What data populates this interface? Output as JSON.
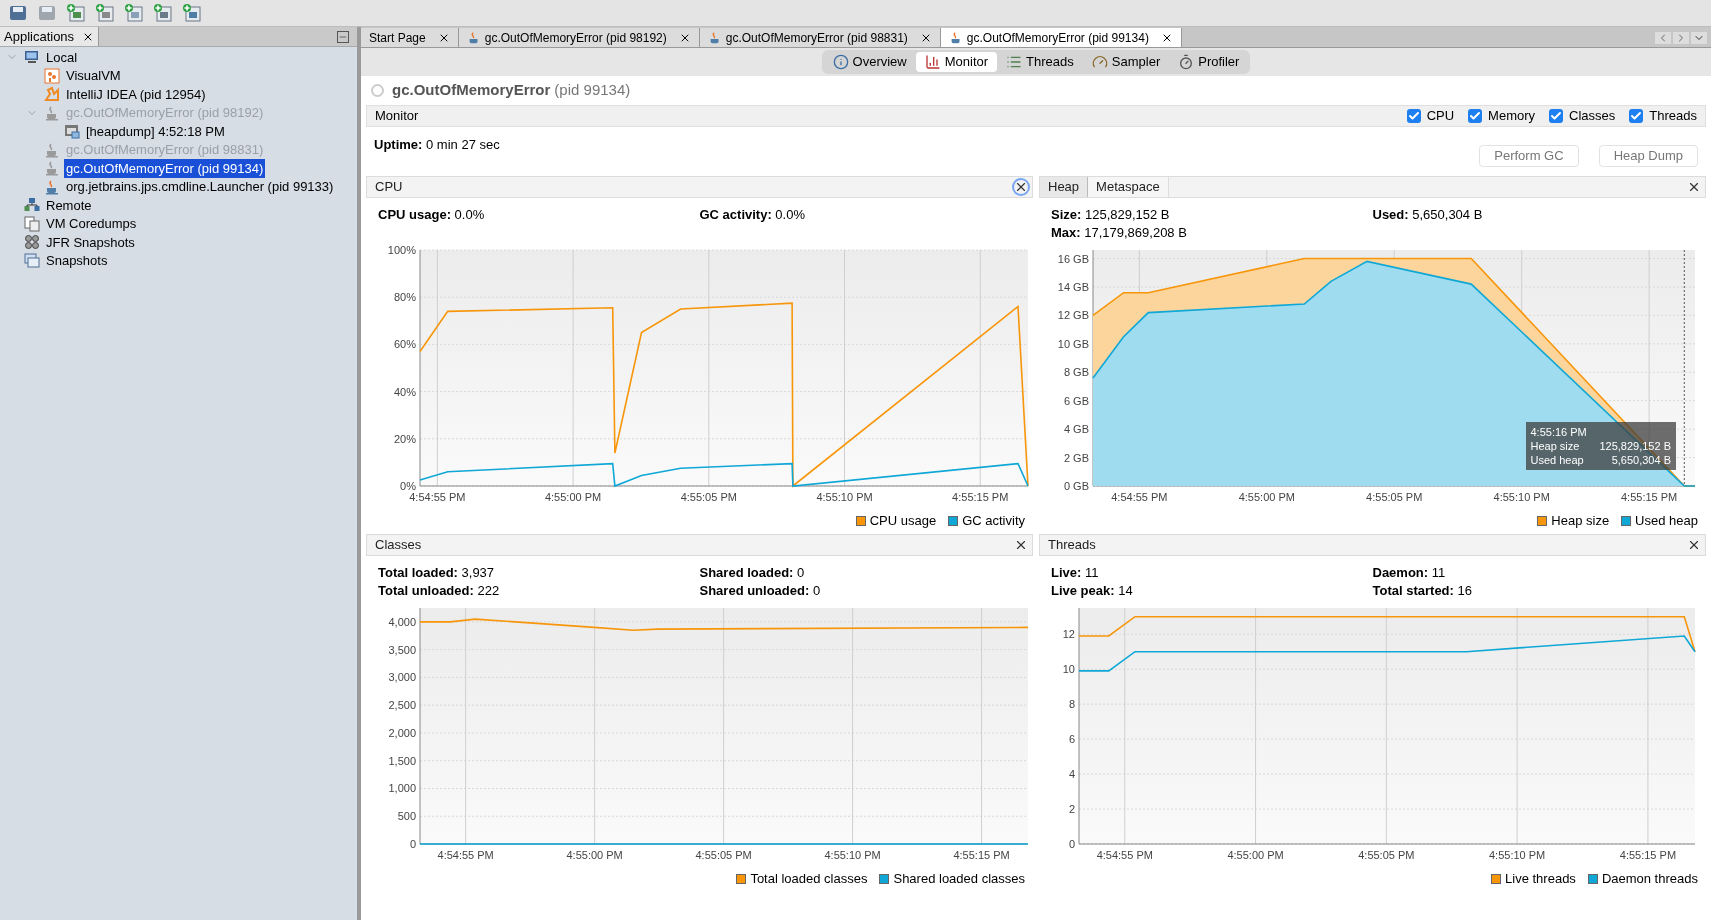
{
  "sidebar": {
    "tab": {
      "label": "Applications"
    },
    "tree": [
      {
        "label": "Local",
        "kind": "host",
        "selected": false,
        "disabled": false,
        "expanded": true,
        "children": [
          {
            "label": "VisualVM",
            "kind": "visualvm",
            "selected": false,
            "disabled": false
          },
          {
            "label": "IntelliJ IDEA (pid 12954)",
            "kind": "idea",
            "selected": false,
            "disabled": false
          },
          {
            "label": "gc.OutOfMemoryError (pid 98192)",
            "kind": "java",
            "selected": false,
            "disabled": true,
            "expanded": true,
            "children": [
              {
                "label": "[heapdump] 4:52:18 PM",
                "kind": "heapdump",
                "selected": false,
                "disabled": false
              }
            ]
          },
          {
            "label": "gc.OutOfMemoryError (pid 98831)",
            "kind": "java",
            "selected": false,
            "disabled": true
          },
          {
            "label": "gc.OutOfMemoryError (pid 99134)",
            "kind": "java",
            "selected": true,
            "disabled": false
          },
          {
            "label": "org.jetbrains.jps.cmdline.Launcher (pid 99133)",
            "kind": "launcher",
            "selected": false,
            "disabled": false
          }
        ]
      },
      {
        "label": "Remote",
        "kind": "remote",
        "selected": false,
        "disabled": false
      },
      {
        "label": "VM Coredumps",
        "kind": "coredumps",
        "selected": false,
        "disabled": false
      },
      {
        "label": "JFR Snapshots",
        "kind": "jfr",
        "selected": false,
        "disabled": false
      },
      {
        "label": "Snapshots",
        "kind": "snapshots",
        "selected": false,
        "disabled": false
      }
    ]
  },
  "tabs": [
    {
      "label": "Start Page",
      "kind": "page",
      "selected": false
    },
    {
      "label": "gc.OutOfMemoryError (pid 98192)",
      "kind": "java",
      "selected": false
    },
    {
      "label": "gc.OutOfMemoryError (pid 98831)",
      "kind": "java",
      "selected": false
    },
    {
      "label": "gc.OutOfMemoryError (pid 99134)",
      "kind": "java",
      "selected": true
    }
  ],
  "views": [
    {
      "label": "Overview",
      "kind": "overview",
      "selected": false
    },
    {
      "label": "Monitor",
      "kind": "monitor",
      "selected": true
    },
    {
      "label": "Threads",
      "kind": "threads",
      "selected": false
    },
    {
      "label": "Sampler",
      "kind": "sampler",
      "selected": false
    },
    {
      "label": "Profiler",
      "kind": "profiler",
      "selected": false
    }
  ],
  "title": {
    "name": "gc.OutOfMemoryError",
    "pid": "(pid 99134)"
  },
  "monitor": {
    "label": "Monitor",
    "checkboxes": [
      {
        "label": "CPU",
        "checked": true
      },
      {
        "label": "Memory",
        "checked": true
      },
      {
        "label": "Classes",
        "checked": true
      },
      {
        "label": "Threads",
        "checked": true
      }
    ],
    "uptime": "**Uptime:** 0 min 27 sec",
    "buttons": [
      "Perform GC",
      "Heap Dump"
    ]
  },
  "cpu": {
    "tabs": [
      {
        "label": "CPU",
        "selected": true
      }
    ],
    "stats": [
      "**CPU usage:** 0.0%",
      "**GC activity:** 0.0%"
    ],
    "chart_data": {
      "type": "line",
      "grid": true,
      "x": [
        60894.36,
        60895.38,
        60901.46,
        60901.54,
        60902.52,
        60903.96,
        60908.07,
        60908.1,
        60916.39,
        60916.76
      ],
      "xlim": [
        60894.36,
        60916.76
      ],
      "ylim": [
        0,
        100
      ],
      "xticks": [
        {
          "value": 60895,
          "label": "4:54:55 PM"
        },
        {
          "value": 60900,
          "label": "4:55:00 PM"
        },
        {
          "value": 60905,
          "label": "4:55:05 PM"
        },
        {
          "value": 60910,
          "label": "4:55:10 PM"
        },
        {
          "value": 60915,
          "label": "4:55:15 PM"
        }
      ],
      "yticks": [
        {
          "value": 0,
          "label": "0%"
        },
        {
          "value": 20,
          "label": "20%"
        },
        {
          "value": 40,
          "label": "40%"
        },
        {
          "value": 60,
          "label": "60%"
        },
        {
          "value": 80,
          "label": "80%"
        },
        {
          "value": 100,
          "label": "100%"
        }
      ],
      "series": [
        {
          "name": "CPU usage",
          "color": "#f7960a",
          "values": [
            57,
            74,
            75.5,
            14,
            65,
            75,
            77.5,
            0,
            76,
            0
          ]
        },
        {
          "name": "GC activity",
          "color": "#0ea7d6",
          "values": [
            2.5,
            6,
            9.5,
            0,
            4.5,
            7.5,
            9.5,
            0,
            9.5,
            0
          ]
        }
      ]
    }
  },
  "memory": {
    "tabs": [
      {
        "label": "Heap",
        "selected": true
      },
      {
        "label": "Metaspace",
        "selected": false
      }
    ],
    "stats": [
      "**Size:** 125,829,152 B",
      "**Used:** 5,650,304 B",
      "**Max:** 17,179,869,208 B"
    ],
    "chart_data": {
      "type": "area",
      "grid": true,
      "x": [
        60893.18,
        60894.38,
        60895.35,
        60901.47,
        60902.52,
        60903.93,
        60908.02,
        60916.38,
        60916.8
      ],
      "xlim": [
        60893.18,
        60916.8
      ],
      "ylim": [
        0,
        16.6
      ],
      "xticks": [
        {
          "value": 60895,
          "label": "4:54:55 PM"
        },
        {
          "value": 60900,
          "label": "4:55:00 PM"
        },
        {
          "value": 60905,
          "label": "4:55:05 PM"
        },
        {
          "value": 60910,
          "label": "4:55:10 PM"
        },
        {
          "value": 60915,
          "label": "4:55:15 PM"
        }
      ],
      "yticks": [
        {
          "value": 0,
          "label": "0 GB"
        },
        {
          "value": 2,
          "label": "2 GB"
        },
        {
          "value": 4,
          "label": "4 GB"
        },
        {
          "value": 6,
          "label": "6 GB"
        },
        {
          "value": 8,
          "label": "8 GB"
        },
        {
          "value": 10,
          "label": "10 GB"
        },
        {
          "value": 12,
          "label": "12 GB"
        },
        {
          "value": 14,
          "label": "14 GB"
        },
        {
          "value": 16,
          "label": "16 GB"
        }
      ],
      "series": [
        {
          "name": "Heap size",
          "color": "#f7960a",
          "values": [
            12,
            13.6,
            13.6,
            16,
            16,
            16,
            16,
            0,
            0
          ]
        },
        {
          "name": "Used heap",
          "color": "#0ea7d6",
          "values": [
            7.6,
            10.5,
            12.2,
            12.8,
            14.4,
            15.8,
            14.2,
            0,
            0
          ]
        }
      ],
      "ref_lines": [
        {
          "axis": "x",
          "value": 60916.38
        }
      ]
    },
    "tooltip": {
      "time": "4:55:16 PM",
      "rows": [
        {
          "label": "Heap size",
          "value": "125,829,152 B"
        },
        {
          "label": "Used heap",
          "value": "5,650,304 B"
        }
      ]
    }
  },
  "classes": {
    "tabs": [
      {
        "label": "Classes",
        "selected": true
      }
    ],
    "stats": [
      "**Total loaded:** 3,937",
      "**Shared loaded:** 0",
      "**Total unloaded:** 222",
      "**Shared unloaded:** 0"
    ],
    "chart_data": {
      "type": "line",
      "grid": true,
      "x": [
        60893.23,
        60894.41,
        60895.37,
        60899.98,
        60901.5,
        60902.43,
        60916.8
      ],
      "xlim": [
        60893.23,
        60916.8
      ],
      "ylim": [
        0,
        4250
      ],
      "xticks": [
        {
          "value": 60895,
          "label": "4:54:55 PM"
        },
        {
          "value": 60900,
          "label": "4:55:00 PM"
        },
        {
          "value": 60905,
          "label": "4:55:05 PM"
        },
        {
          "value": 60910,
          "label": "4:55:10 PM"
        },
        {
          "value": 60915,
          "label": "4:55:15 PM"
        }
      ],
      "yticks": [
        {
          "value": 0,
          "label": "0"
        },
        {
          "value": 500,
          "label": "500"
        },
        {
          "value": 1000,
          "label": "1,000"
        },
        {
          "value": 1500,
          "label": "1,500"
        },
        {
          "value": 2000,
          "label": "2,000"
        },
        {
          "value": 2500,
          "label": "2,500"
        },
        {
          "value": 3000,
          "label": "3,000"
        },
        {
          "value": 3500,
          "label": "3,500"
        },
        {
          "value": 4000,
          "label": "4,000"
        }
      ],
      "series": [
        {
          "name": "Total loaded classes",
          "color": "#f7960a",
          "values": [
            4000,
            4000,
            4050,
            3900,
            3850,
            3870,
            3900
          ]
        },
        {
          "name": "Shared loaded classes",
          "color": "#0ea7d6",
          "values": [
            0,
            0,
            0,
            0,
            0,
            0,
            0
          ]
        }
      ]
    }
  },
  "threads": {
    "tabs": [
      {
        "label": "Threads",
        "selected": true
      }
    ],
    "stats": [
      "**Live:** 11",
      "**Daemon:** 11",
      "**Live peak:** 14",
      "**Total started:** 16"
    ],
    "chart_data": {
      "type": "line",
      "grid": true,
      "x": [
        60893.25,
        60894.39,
        60895.39,
        60908.06,
        60916.39,
        60916.8
      ],
      "xlim": [
        60893.25,
        60916.8
      ],
      "ylim": [
        0,
        13.5
      ],
      "xticks": [
        {
          "value": 60895,
          "label": "4:54:55 PM"
        },
        {
          "value": 60900,
          "label": "4:55:00 PM"
        },
        {
          "value": 60905,
          "label": "4:55:05 PM"
        },
        {
          "value": 60910,
          "label": "4:55:10 PM"
        },
        {
          "value": 60915,
          "label": "4:55:15 PM"
        }
      ],
      "yticks": [
        {
          "value": 0,
          "label": "0"
        },
        {
          "value": 2,
          "label": "2"
        },
        {
          "value": 4,
          "label": "4"
        },
        {
          "value": 6,
          "label": "6"
        },
        {
          "value": 8,
          "label": "8"
        },
        {
          "value": 10,
          "label": "10"
        },
        {
          "value": 12,
          "label": "12"
        }
      ],
      "series": [
        {
          "name": "Live threads",
          "color": "#f7960a",
          "values": [
            11.9,
            11.9,
            13,
            13,
            13,
            11
          ]
        },
        {
          "name": "Daemon threads",
          "color": "#0ea7d6",
          "values": [
            9.9,
            9.9,
            11,
            11,
            11.9,
            11
          ]
        }
      ]
    }
  }
}
